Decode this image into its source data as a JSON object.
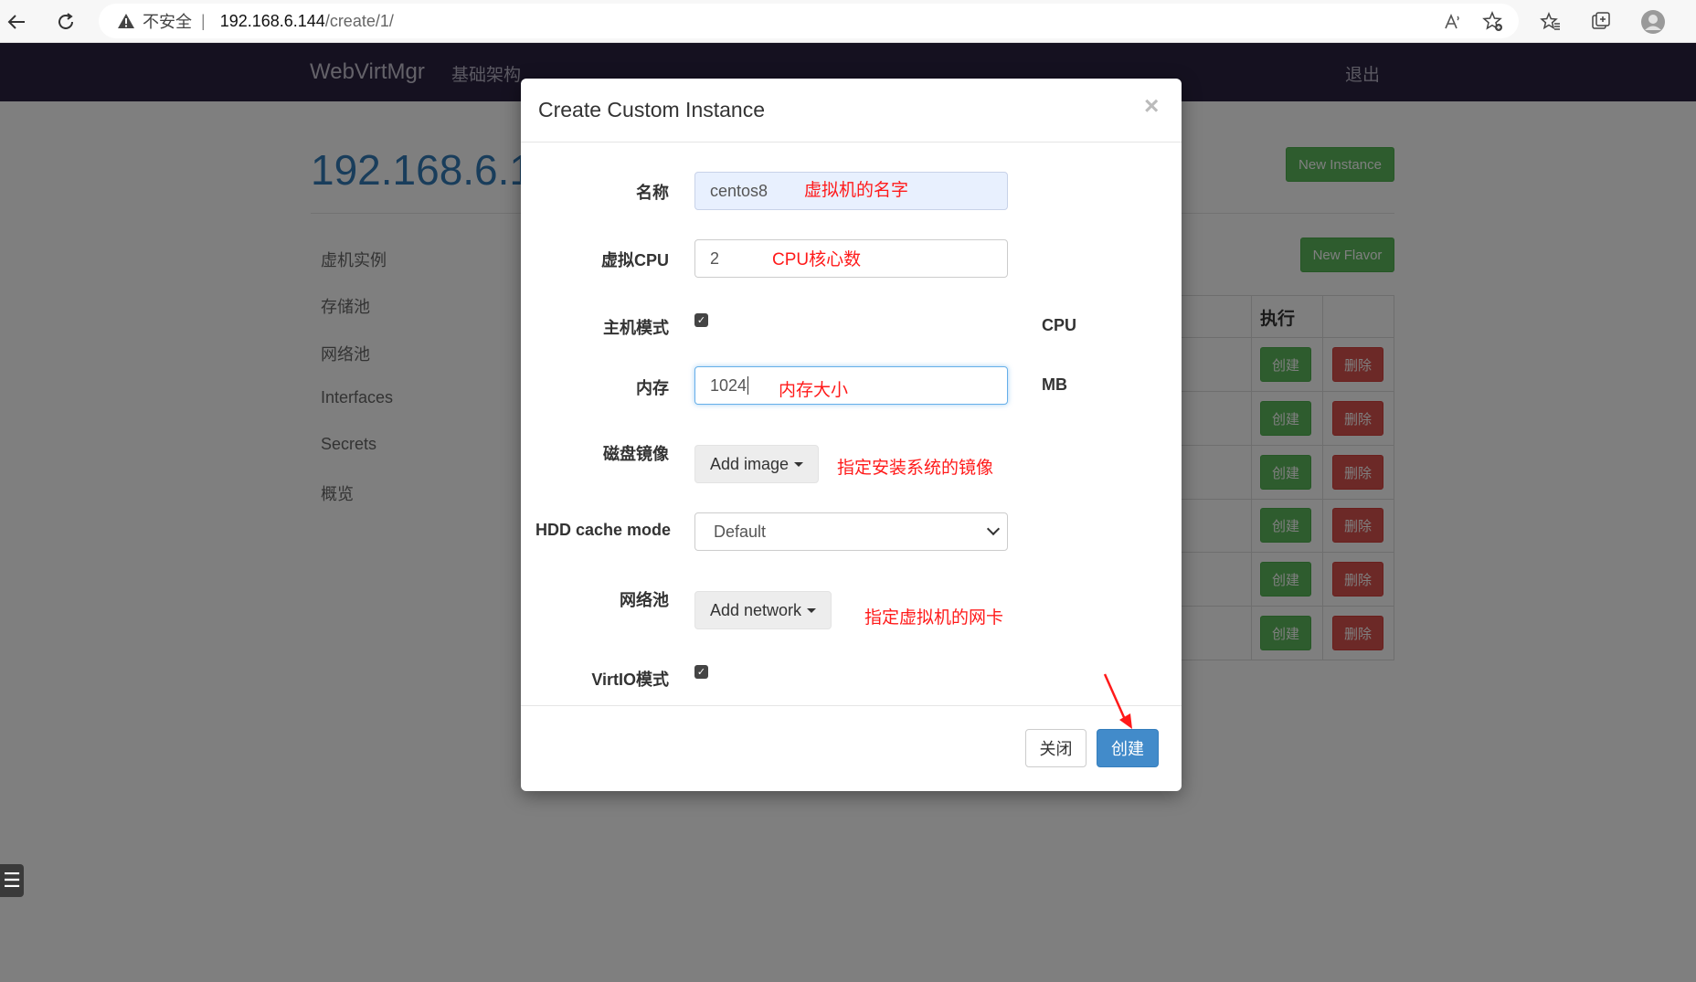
{
  "browser": {
    "security_warning": "不安全",
    "separator": "|",
    "url_host": "192.168.6.144",
    "url_path": "/create/1/"
  },
  "navbar": {
    "brand": "WebVirtMgr",
    "infrastructure": "基础架构",
    "logout": "退出"
  },
  "page": {
    "host_title": "192.168.6.1",
    "new_instance": "New Instance",
    "new_flavor": "New Flavor",
    "sidebar": [
      "虚机实例",
      "存储池",
      "网络池",
      "Interfaces",
      "Secrets",
      "概览"
    ],
    "table": {
      "action_header": "执行",
      "rows": [
        {
          "create": "创建",
          "delete": "删除"
        },
        {
          "create": "创建",
          "delete": "删除"
        },
        {
          "create": "创建",
          "delete": "删除"
        },
        {
          "create": "创建",
          "delete": "删除"
        },
        {
          "create": "创建",
          "delete": "删除"
        },
        {
          "create": "创建",
          "delete": "删除"
        }
      ]
    }
  },
  "modal": {
    "title": "Create Custom Instance",
    "close": "×",
    "fields": {
      "name": {
        "label": "名称",
        "value": "centos8",
        "note": "虚拟机的名字"
      },
      "vcpu": {
        "label": "虚拟CPU",
        "value": "2",
        "note": "CPU核心数"
      },
      "host_model": {
        "label": "主机模式",
        "unit": "CPU"
      },
      "memory": {
        "label": "内存",
        "value": "1024",
        "unit": "MB",
        "note": "内存大小"
      },
      "disk_image": {
        "label": "磁盘镜像",
        "button": "Add image",
        "note": "指定安装系统的镜像"
      },
      "cache_mode": {
        "label": "HDD cache mode",
        "selected": "Default"
      },
      "network": {
        "label": "网络池",
        "button": "Add network",
        "note": "指定虚拟机的网卡"
      },
      "virtio": {
        "label": "VirtIO模式"
      }
    },
    "footer": {
      "close_label": "关闭",
      "create_label": "创建"
    }
  },
  "colors": {
    "navbar": "#2a2340",
    "primary": "#428bca",
    "success": "#5cb85c",
    "danger": "#d9534f",
    "annotation": "#ff1a1a"
  }
}
